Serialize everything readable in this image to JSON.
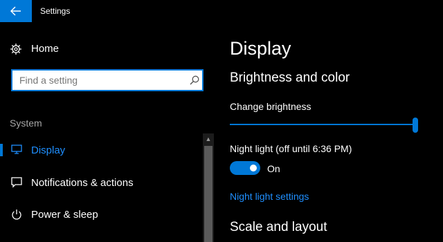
{
  "titlebar": {
    "back_icon": "back-arrow-icon",
    "title": "Settings",
    "accent": "#0078d7"
  },
  "sidebar": {
    "home_icon": "gear-icon",
    "home_label": "Home",
    "search": {
      "value": "",
      "placeholder": "Find a setting",
      "icon": "search-icon"
    },
    "section_label": "System",
    "items": [
      {
        "label": "Display",
        "icon": "monitor-icon",
        "active": true
      },
      {
        "label": "Notifications & actions",
        "icon": "message-icon",
        "active": false
      },
      {
        "label": "Power & sleep",
        "icon": "power-icon",
        "active": false
      }
    ]
  },
  "main": {
    "title": "Display",
    "brightness_section": {
      "heading": "Brightness and color",
      "brightness_label": "Change brightness",
      "brightness_level": 1.0,
      "night_light_label": "Night light (off until 6:36 PM)",
      "night_light_state": "On",
      "night_light_link": "Night light settings"
    },
    "scale_section": {
      "heading": "Scale and layout"
    }
  }
}
